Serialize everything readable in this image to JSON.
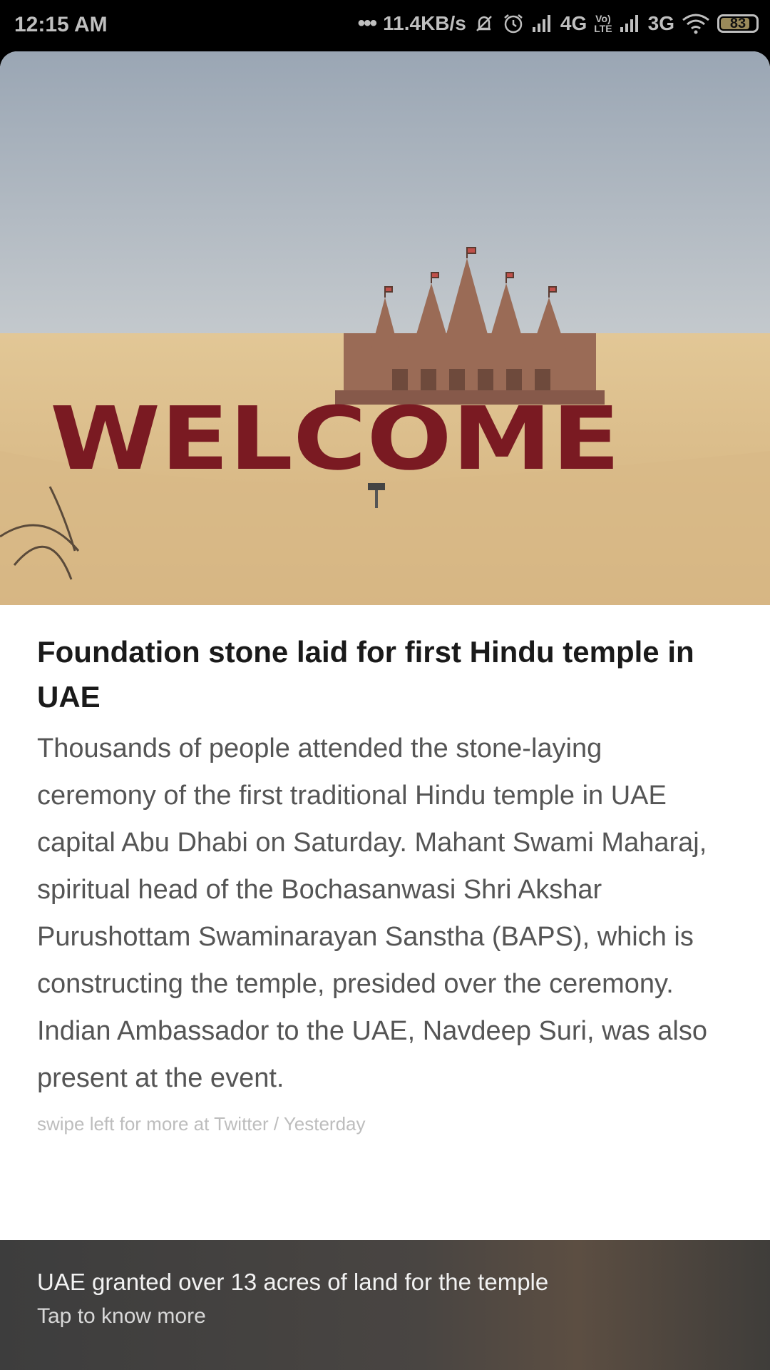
{
  "status_bar": {
    "time": "12:15 AM",
    "more_indicator": "•••",
    "network_speed": "11.4KB/s",
    "mute_icon": "bell-off-icon",
    "alarm_icon": "alarm-icon",
    "sim1_type": "4G",
    "volte_top": "Vo)",
    "volte_bottom": "LTE",
    "sim2_type": "3G",
    "wifi_icon": "wifi-icon",
    "battery_level": "83",
    "battery_fraction": 0.83
  },
  "article": {
    "image_sign_text": "WELCOME",
    "headline": "Foundation stone laid for first Hindu temple in UAE",
    "body": "Thousands of people attended the stone-laying ceremony of the first traditional Hindu temple in UAE capital Abu Dhabi on Saturday. Mahant Swami Maharaj, spiritual head of the Bochasanwasi Shri Akshar Purushottam Swaminarayan Sanstha (BAPS), which is constructing the temple, presided over the ceremony. Indian Ambassador to the UAE, Navdeep Suri, was also present at the event.",
    "source_line": "swipe left for more at Twitter / Yesterday"
  },
  "bottom_panel": {
    "title": "UAE granted over 13 acres of land for the temple",
    "subtitle": "Tap to know more"
  },
  "colors": {
    "sign_red": "#7a1a22",
    "sand": "#dcbd8a",
    "sky": "#a9b2bd",
    "temple": "#9a6b56"
  }
}
